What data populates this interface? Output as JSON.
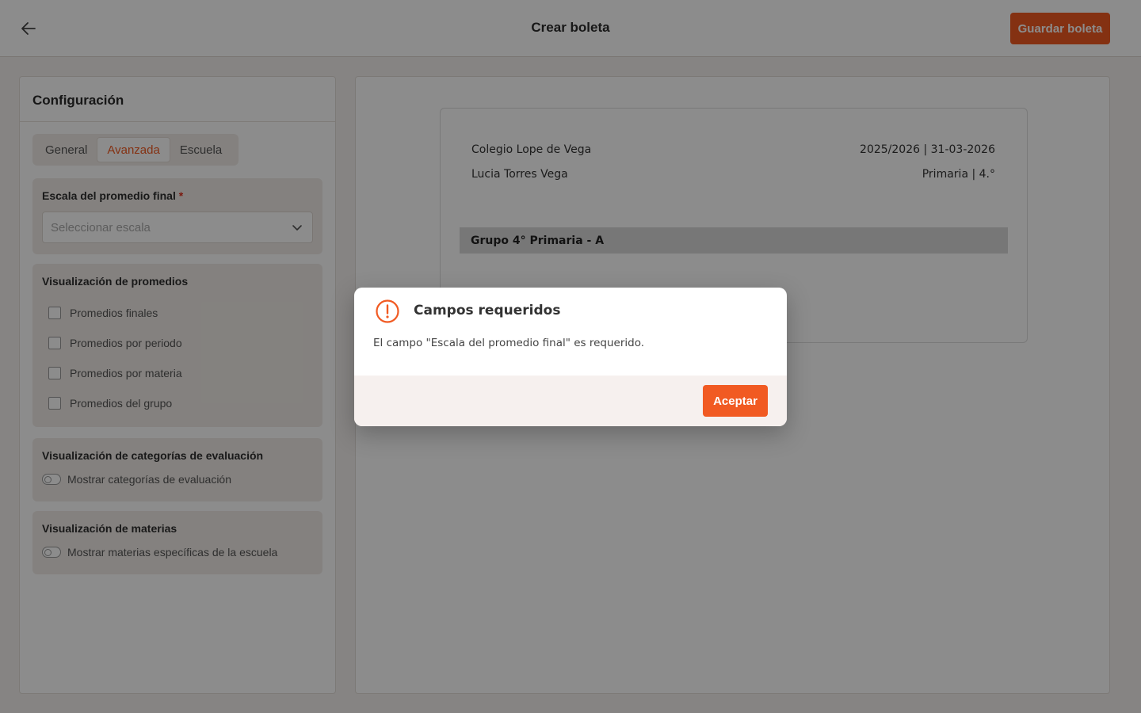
{
  "header": {
    "title": "Crear boleta",
    "save_label": "Guardar boleta"
  },
  "config": {
    "title": "Configuración",
    "tabs": [
      {
        "label": "General",
        "active": false
      },
      {
        "label": "Avanzada",
        "active": true
      },
      {
        "label": "Escuela",
        "active": false
      }
    ],
    "scale": {
      "title": "Escala del promedio final",
      "required_mark": "*",
      "placeholder": "Seleccionar escala"
    },
    "averages": {
      "title": "Visualización de promedios",
      "options": [
        {
          "label": "Promedios finales",
          "checked": false
        },
        {
          "label": "Promedios por periodo",
          "checked": false
        },
        {
          "label": "Promedios por materia",
          "checked": false
        },
        {
          "label": "Promedios del grupo",
          "checked": false
        }
      ]
    },
    "categories": {
      "title": "Visualización de categorías de evaluación",
      "toggle_label": "Mostrar categorías de evaluación",
      "enabled": false
    },
    "subjects": {
      "title": "Visualización de materias",
      "toggle_label": "Mostrar materias específicas de la escuela",
      "enabled": false
    }
  },
  "preview": {
    "school": "Colegio Lope de Vega",
    "period": "2025/2026 | 31-03-2026",
    "student": "Lucia Torres Vega",
    "level": "Primaria | 4.°",
    "group": "Grupo 4° Primaria - A"
  },
  "dialog": {
    "title": "Campos requeridos",
    "message": "El campo \"Escala del promedio final\" es requerido.",
    "accept_label": "Aceptar"
  },
  "colors": {
    "accent": "#f15a22",
    "required": "#e0301e"
  }
}
